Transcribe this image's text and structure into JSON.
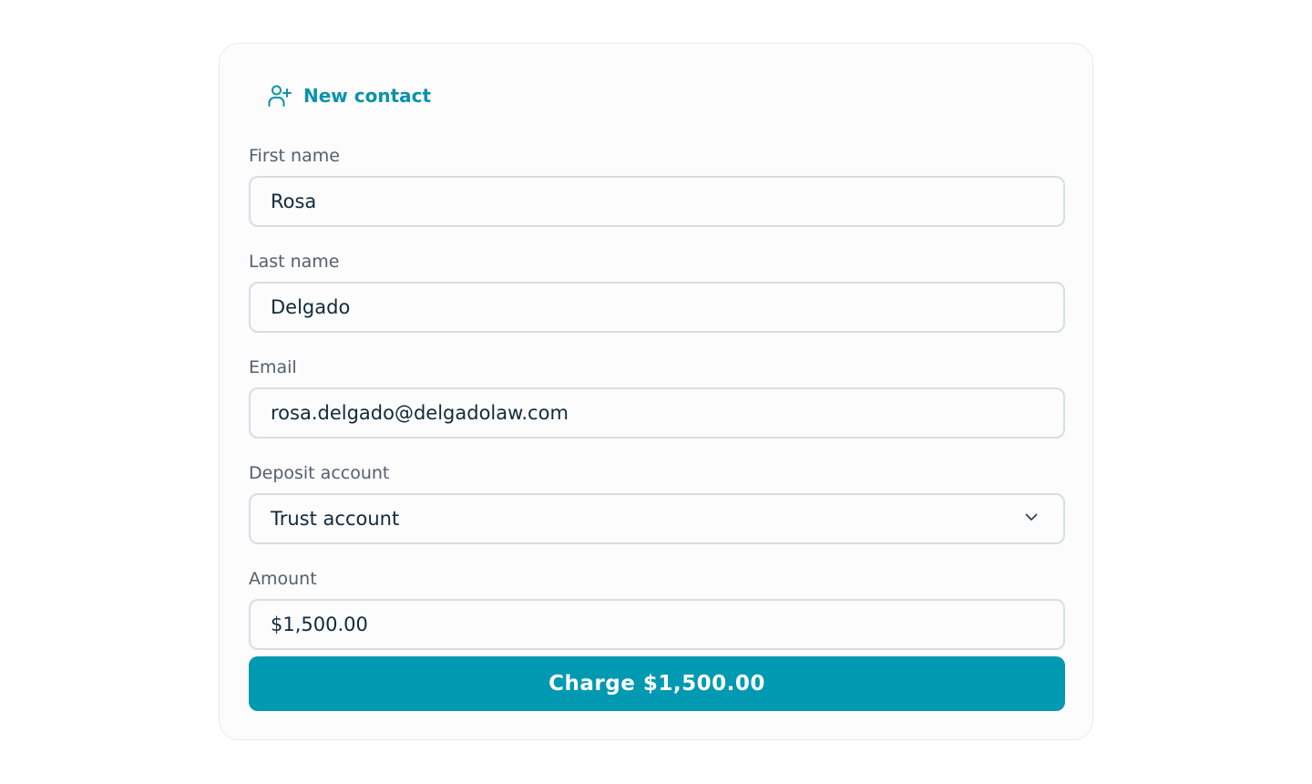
{
  "header": {
    "new_contact_label": "New contact",
    "icon": "user-plus-icon",
    "accent_color": "#0a93a8"
  },
  "form": {
    "first_name": {
      "label": "First name",
      "value": "Rosa"
    },
    "last_name": {
      "label": "Last name",
      "value": "Delgado"
    },
    "email": {
      "label": "Email",
      "value": "rosa.delgado@delgadolaw.com"
    },
    "deposit_account": {
      "label": "Deposit account",
      "selected": "Trust account",
      "icon": "chevron-down-icon"
    },
    "amount": {
      "label": "Amount",
      "value": "$1,500.00"
    }
  },
  "actions": {
    "charge_label": "Charge $1,500.00",
    "button_color": "#0099b2"
  }
}
